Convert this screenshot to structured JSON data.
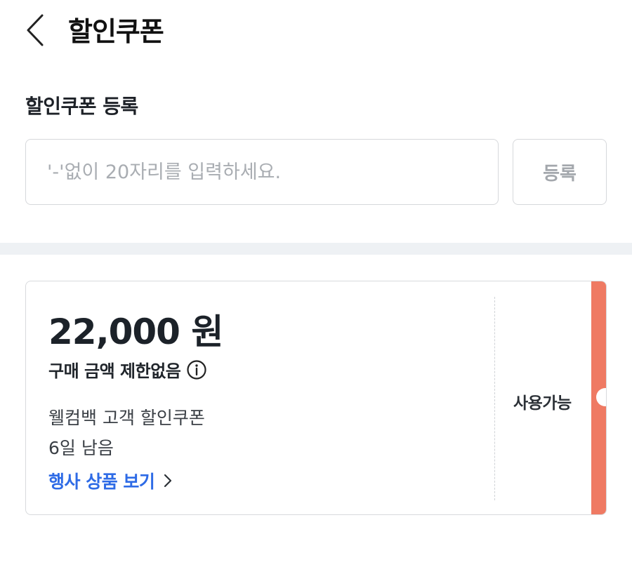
{
  "header": {
    "title": "할인쿠폰",
    "back_icon": "chevron-left-icon"
  },
  "register_section": {
    "title": "할인쿠폰 등록",
    "input_placeholder": "'-'없이 20자리를 입력하세요.",
    "input_value": "",
    "register_button_label": "등록"
  },
  "coupon": {
    "amount": "22,000 원",
    "condition": "구매 금액 제한없음",
    "info_icon": "info-icon",
    "name": "웰컴백 고객 할인쿠폰",
    "expiry": "6일 남음",
    "event_link_label": "행사 상품 보기",
    "status": "사용가능",
    "accent_color": "#ef7a63",
    "link_color": "#2e6be6"
  }
}
